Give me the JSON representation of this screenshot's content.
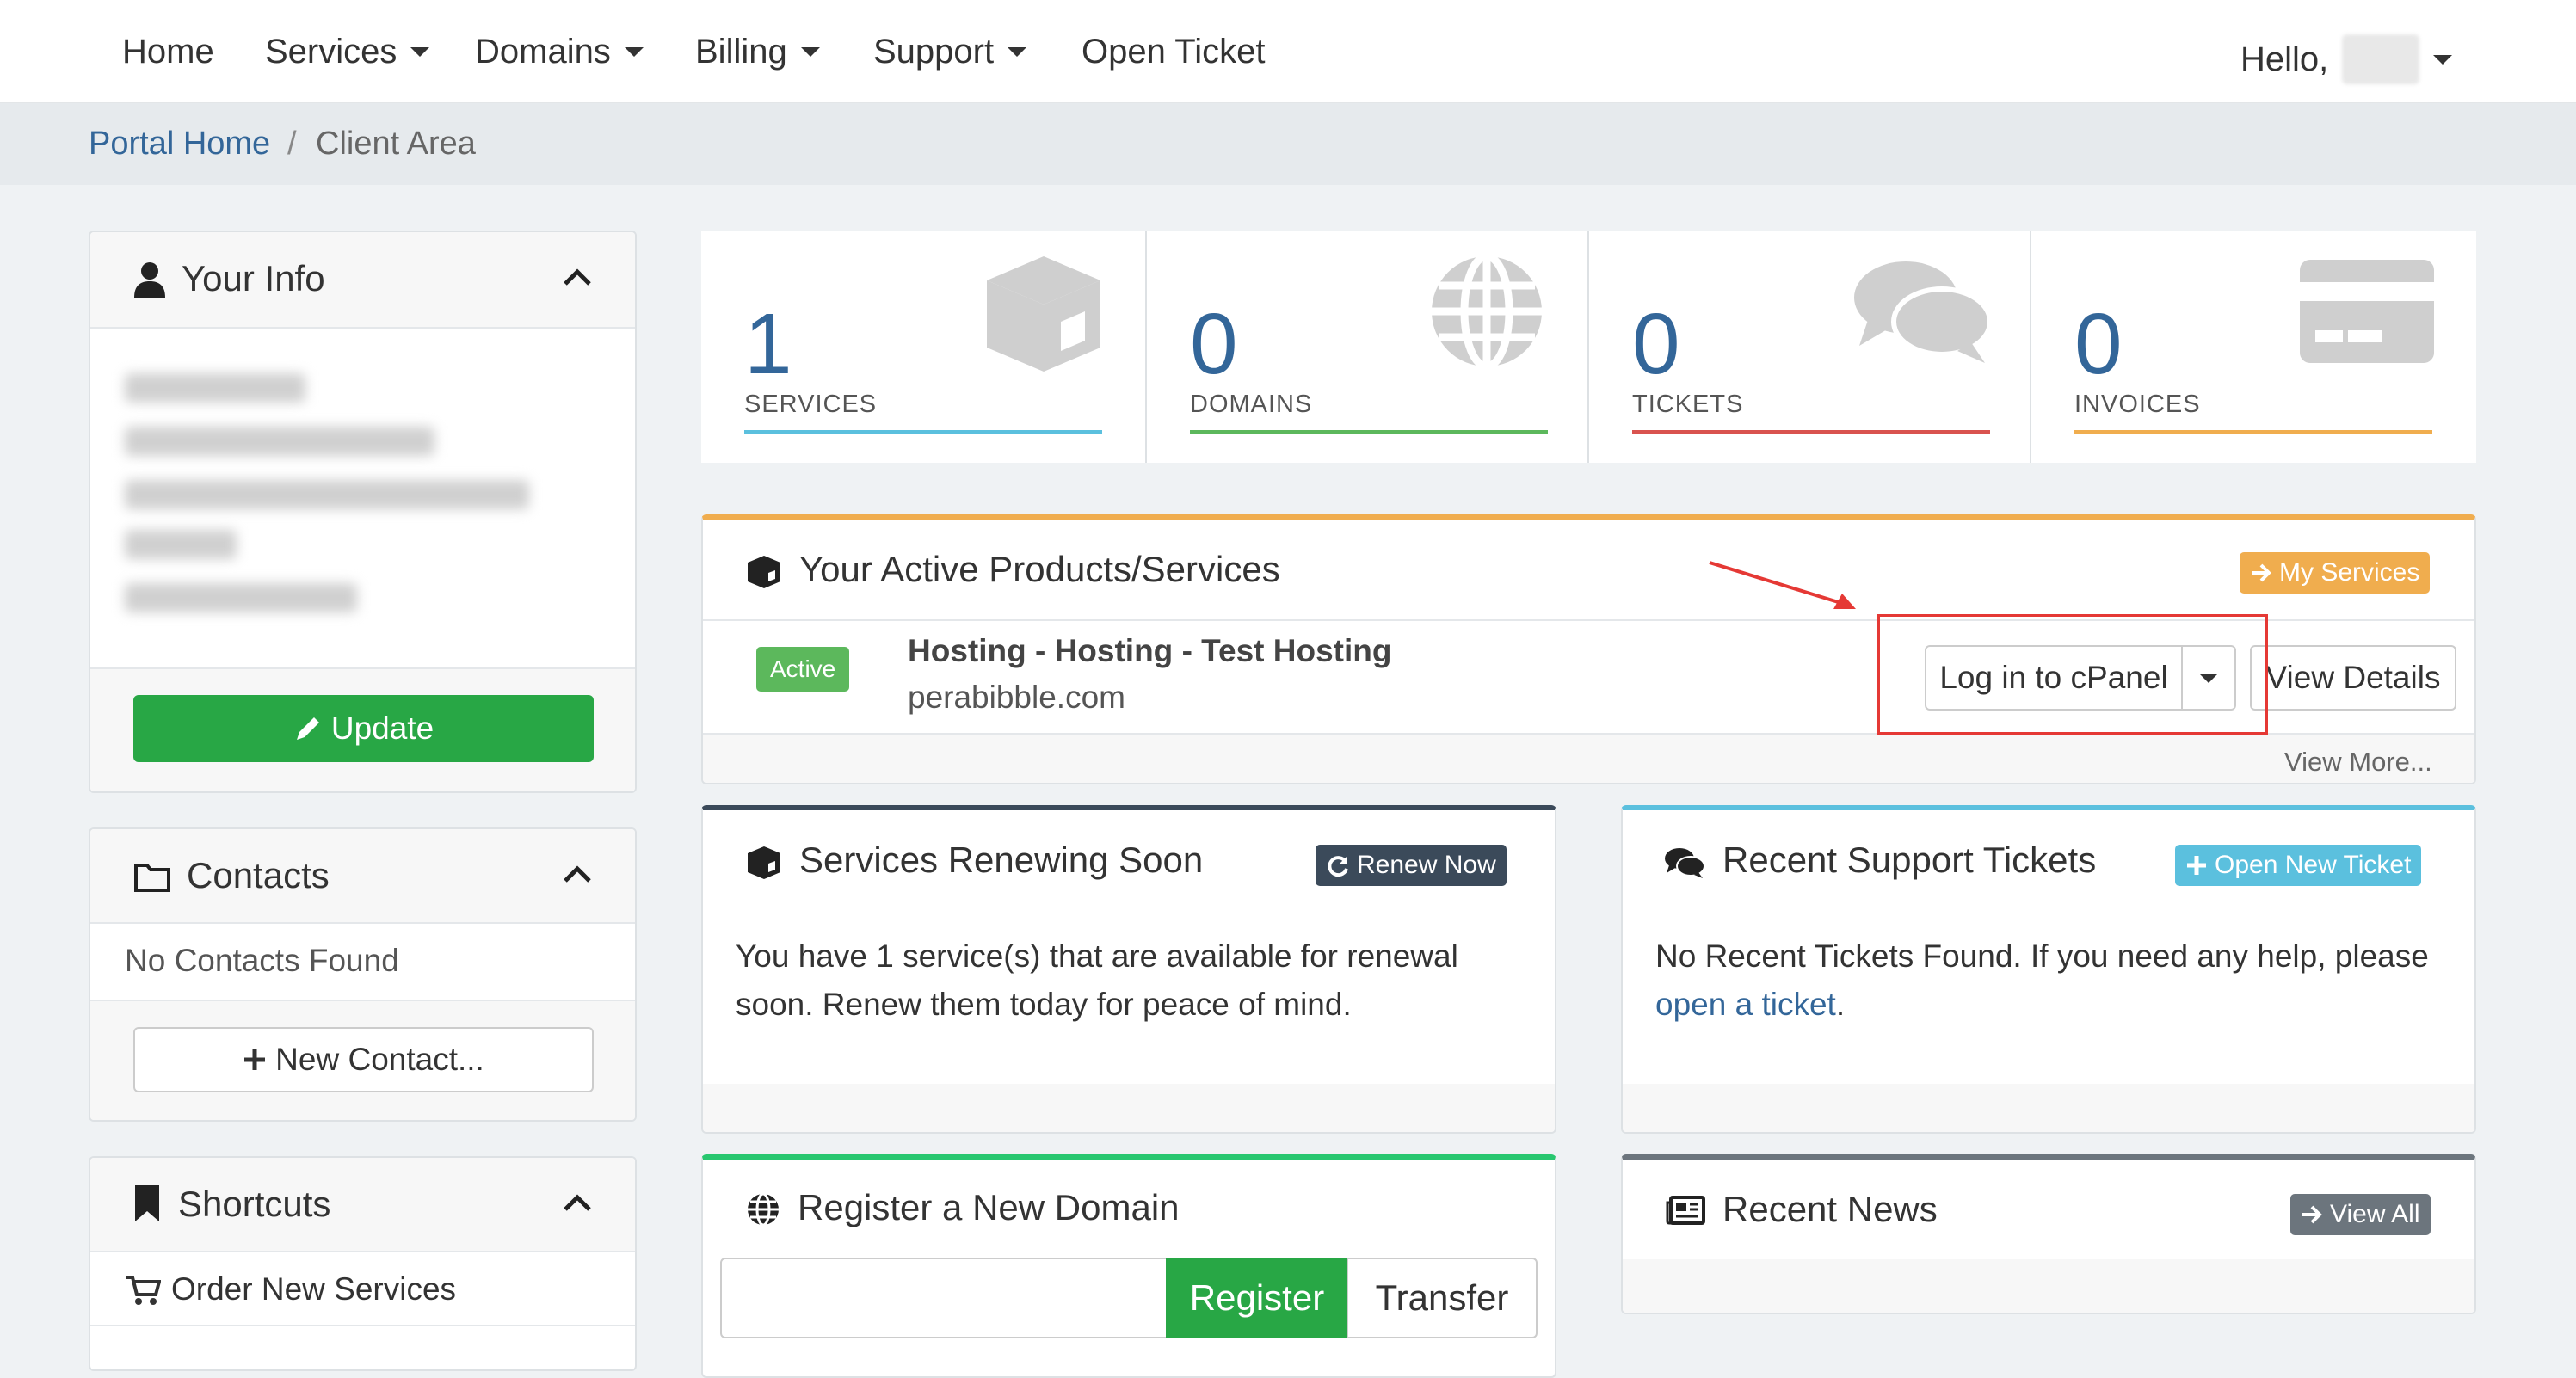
{
  "navbar": {
    "items": [
      {
        "label": "Home"
      },
      {
        "label": "Services"
      },
      {
        "label": "Domains"
      },
      {
        "label": "Billing"
      },
      {
        "label": "Support"
      },
      {
        "label": "Open Ticket"
      }
    ],
    "greeting": "Hello,"
  },
  "breadcrumb": {
    "home": "Portal Home",
    "separator": "/",
    "current": "Client Area"
  },
  "sidebar": {
    "your_info": {
      "title": "Your Info",
      "update_label": "Update"
    },
    "contacts": {
      "title": "Contacts",
      "empty_text": "No Contacts Found",
      "new_contact_label": "New Contact..."
    },
    "shortcuts": {
      "title": "Shortcuts",
      "items": [
        {
          "label": "Order New Services"
        }
      ]
    }
  },
  "stats": [
    {
      "value": "1",
      "label": "SERVICES",
      "color": "#5bc0de",
      "icon": "cube-icon"
    },
    {
      "value": "0",
      "label": "DOMAINS",
      "color": "#5cb85c",
      "icon": "globe-icon"
    },
    {
      "value": "0",
      "label": "TICKETS",
      "color": "#d9534f",
      "icon": "comments-icon"
    },
    {
      "value": "0",
      "label": "INVOICES",
      "color": "#f0ad4e",
      "icon": "credit-card-icon"
    }
  ],
  "active_products": {
    "title": "Your Active Products/Services",
    "my_services_label": "My Services",
    "service": {
      "status": "Active",
      "name": "Hosting - Hosting - Test Hosting",
      "domain": "perabibble.com",
      "login_label": "Log in to cPanel",
      "view_details_label": "View Details"
    },
    "view_more_label": "View More..."
  },
  "renewing": {
    "title": "Services Renewing Soon",
    "renew_label": "Renew Now",
    "text_line1": "You have 1 service(s) that are available for renewal",
    "text_line2": "soon. Renew them today for peace of mind."
  },
  "tickets": {
    "title": "Recent Support Tickets",
    "open_label": "Open New Ticket",
    "text_line1": "No Recent Tickets Found. If you need any help, please",
    "link_text": "open a ticket",
    "text_end": "."
  },
  "register_domain": {
    "title": "Register a New Domain",
    "input_value": "",
    "register_label": "Register",
    "transfer_label": "Transfer"
  },
  "news": {
    "title": "Recent News",
    "view_all_label": "View All"
  },
  "colors": {
    "accent_blue": "#336699",
    "success": "#28a745",
    "warning": "#f0ad4e",
    "info": "#5bc0de",
    "dark": "#3b4a5a",
    "secondary": "#6c757d",
    "annotation_red": "#e53935"
  }
}
